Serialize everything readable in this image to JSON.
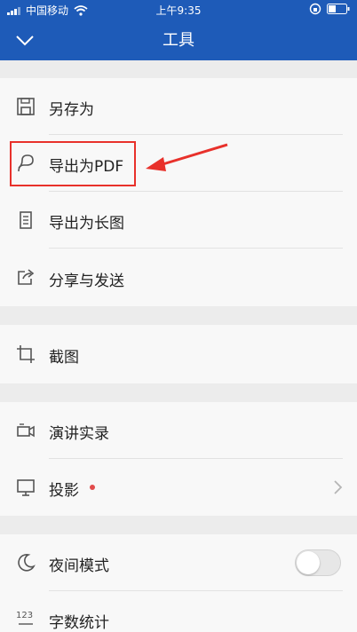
{
  "status_bar": {
    "carrier": "中国移动",
    "time": "上午9:35"
  },
  "header": {
    "title": "工具"
  },
  "tools": {
    "save_as": "另存为",
    "export_pdf": "导出为PDF",
    "export_long_image": "导出为长图",
    "share_send": "分享与发送",
    "screenshot": "截图",
    "presentation_record": "演讲实录",
    "projection": "投影",
    "night_mode": "夜间模式",
    "word_count": "字数统计"
  },
  "night_mode_enabled": false,
  "colors": {
    "header": "#1e5bb8",
    "highlight": "#e8312b",
    "badge": "#e24b4b"
  },
  "icons": [
    "chevron-down-icon",
    "wifi-icon",
    "battery-icon",
    "save-icon",
    "pdf-icon",
    "long-image-icon",
    "share-icon",
    "crop-icon",
    "video-camera-icon",
    "monitor-icon",
    "moon-icon",
    "word-count-icon",
    "chevron-right-icon"
  ]
}
